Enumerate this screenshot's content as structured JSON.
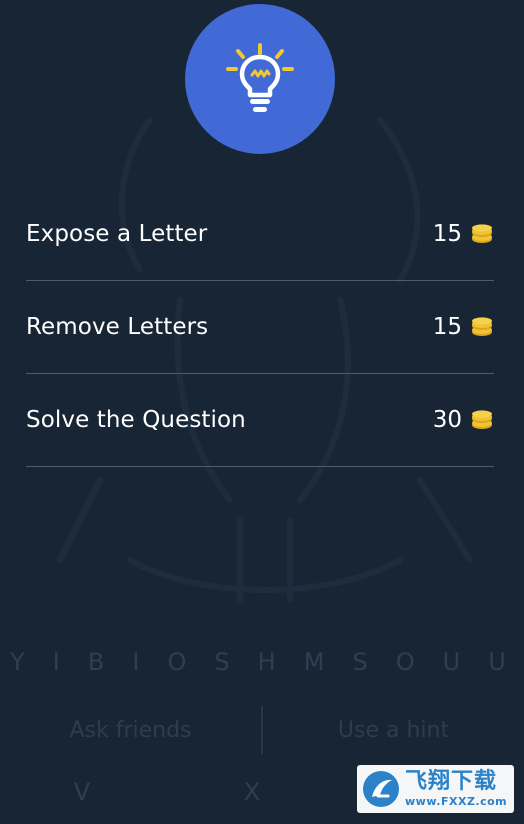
{
  "hint_dialog": {
    "icon": "lightbulb-icon",
    "icon_circle_color": "#416ad6",
    "bulb_color": "#ffffff",
    "ray_color": "#f1c82f"
  },
  "options": [
    {
      "label": "Expose a Letter",
      "cost": "15",
      "icon": "coins-icon"
    },
    {
      "label": "Remove Letters",
      "cost": "15",
      "icon": "coins-icon"
    },
    {
      "label": "Solve the Question",
      "cost": "30",
      "icon": "coins-icon"
    }
  ],
  "background": {
    "letter_row": [
      "Y",
      "I",
      "B",
      "I",
      "O",
      "S",
      "H",
      "M",
      "S",
      "O",
      "U",
      "U"
    ],
    "ask_friends_label": "Ask friends",
    "use_hint_label": "Use a hint",
    "letter_row_2": [
      "V",
      "X"
    ]
  },
  "watermark": {
    "name": "飞翔下载",
    "url": "www.FXXZ.com"
  },
  "colors": {
    "background": "#1a2737",
    "divider": "#4d5c6c",
    "coin": "#f1c232",
    "watermark_text": "#2b82c9"
  }
}
